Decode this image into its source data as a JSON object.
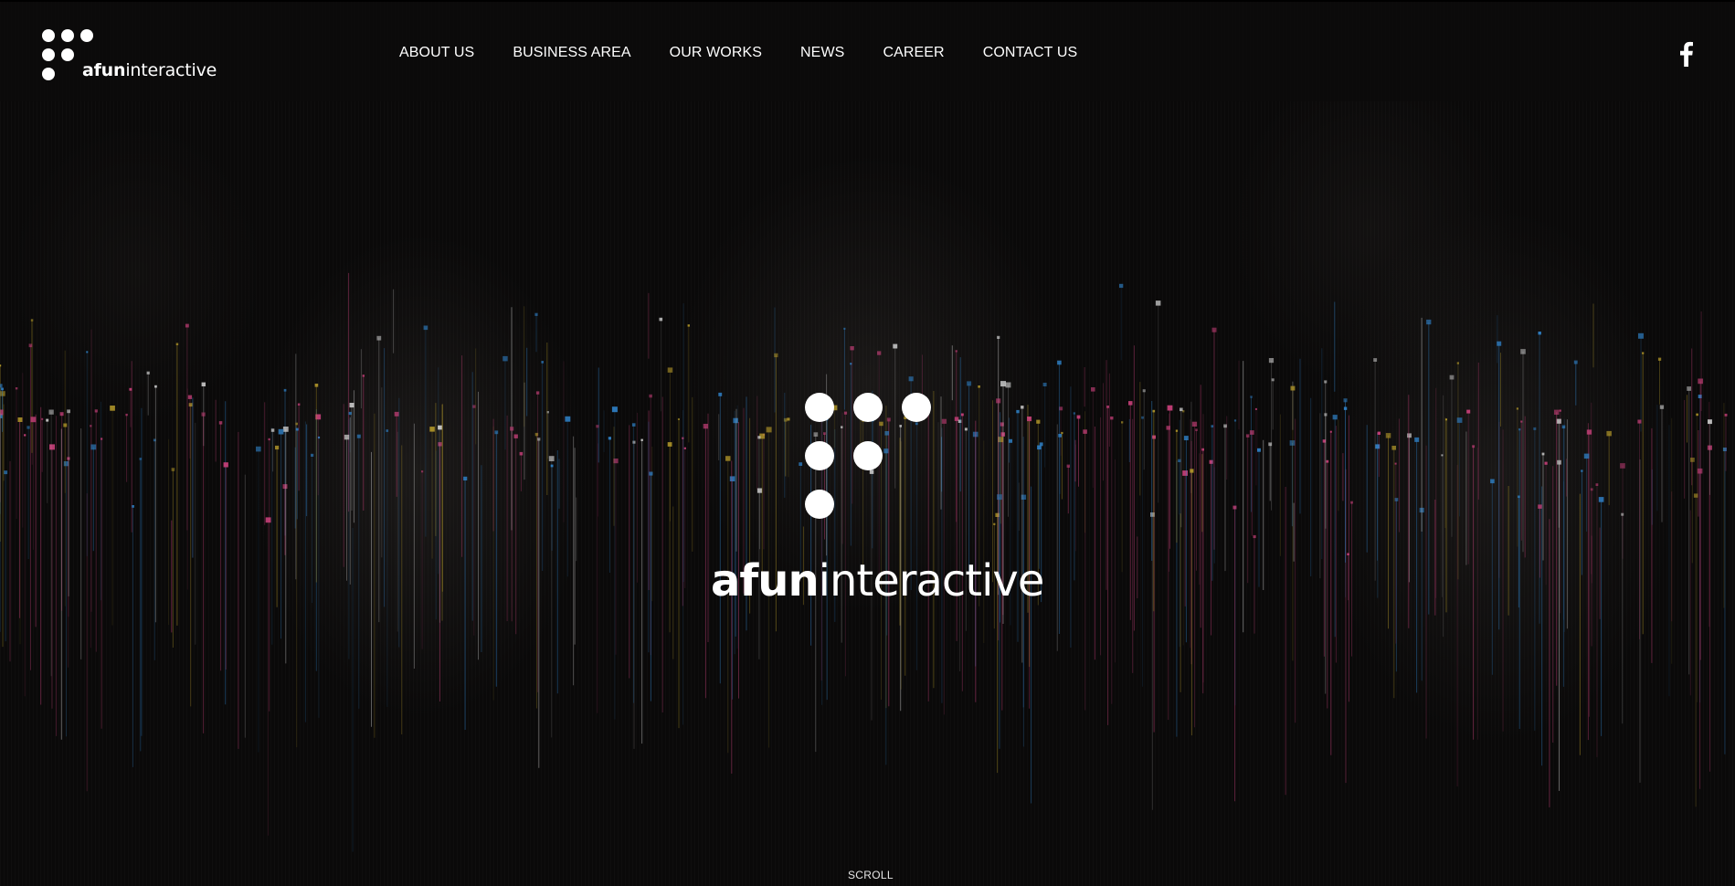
{
  "brand": {
    "name_bold": "afun",
    "name_light": "interactive"
  },
  "nav": {
    "items": [
      {
        "label": "ABOUT US"
      },
      {
        "label": "BUSINESS AREA"
      },
      {
        "label": "OUR WORKS"
      },
      {
        "label": "NEWS"
      },
      {
        "label": "CAREER"
      },
      {
        "label": "CONTACT US"
      }
    ]
  },
  "social": {
    "icon": "facebook-icon"
  },
  "hero": {
    "scroll_label": "SCROLL"
  },
  "colors": {
    "background": "#0a0909",
    "text": "#ffffff",
    "particle_pink": "#c8407a",
    "particle_blue": "#2f7fc4",
    "particle_yellow": "#b59a2a",
    "particle_white": "#cfcfcf"
  }
}
